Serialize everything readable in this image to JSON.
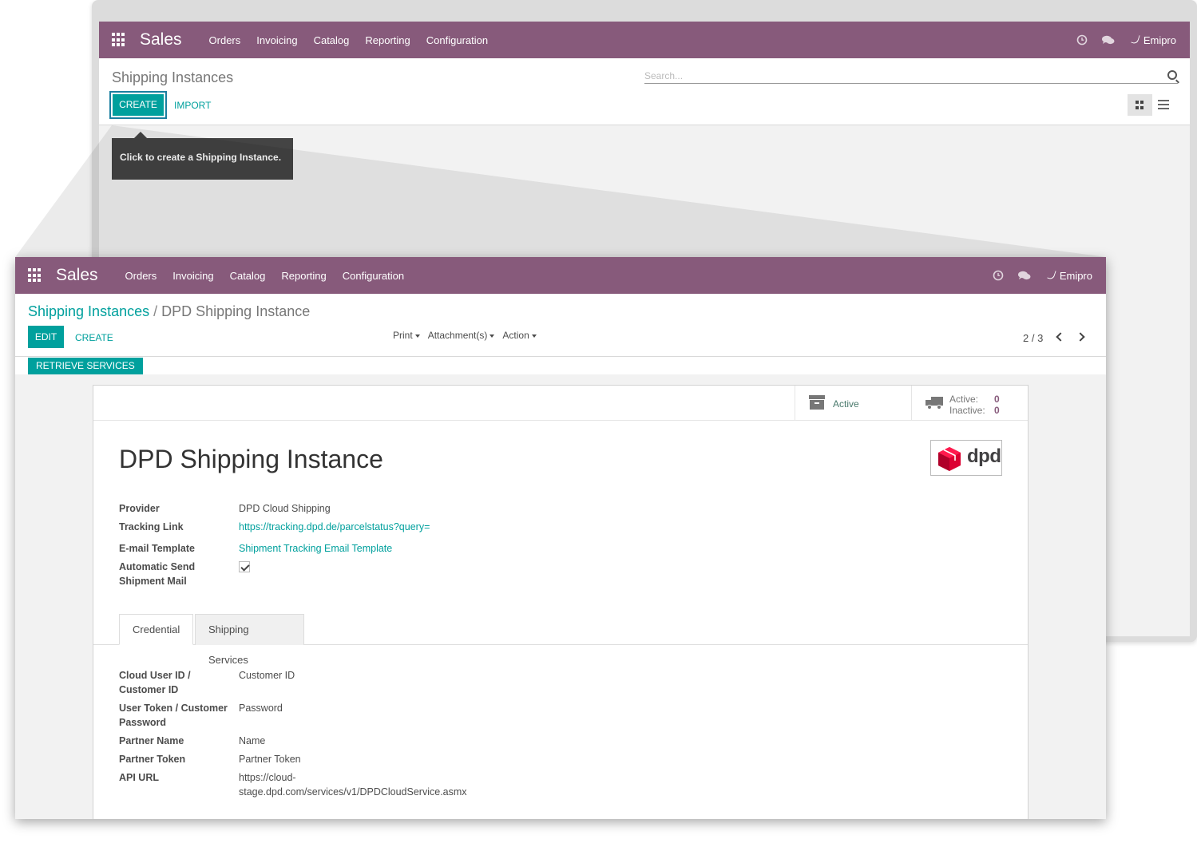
{
  "app": {
    "brand": "Sales",
    "user": "Emipro"
  },
  "menu": [
    "Orders",
    "Invoicing",
    "Catalog",
    "Reporting",
    "Configuration"
  ],
  "back": {
    "title": "Shipping Instances",
    "search_placeholder": "Search...",
    "create_label": "CREATE",
    "import_label": "IMPORT",
    "tooltip": "Click to create a Shipping Instance."
  },
  "front": {
    "breadcrumb_parent": "Shipping Instances",
    "breadcrumb_sep": "/",
    "breadcrumb_current": "DPD Shipping Instance",
    "edit_label": "EDIT",
    "create_label": "CREATE",
    "dropdowns": [
      "Print",
      "Attachment(s)",
      "Action"
    ],
    "pager": "2 / 3",
    "retrieve_label": "RETRIEVE SERVICES",
    "active_label": "Active",
    "counts": {
      "active_label": "Active:",
      "active_value": "0",
      "inactive_label": "Inactive:",
      "inactive_value": "0"
    },
    "record_title": "DPD Shipping Instance",
    "logo_text": "dpd",
    "fields": [
      {
        "label": "Provider",
        "value": "DPD Cloud Shipping"
      },
      {
        "label": "Tracking Link",
        "value": "https://tracking.dpd.de/parcelstatus?query="
      },
      {
        "label": "E-mail Template",
        "value": "Shipment Tracking Email Template"
      },
      {
        "label": "Automatic Send Shipment Mail",
        "checked": true
      }
    ],
    "tabs": [
      "Credential",
      "Shipping Services"
    ],
    "credentials": [
      {
        "label": "Cloud User ID / Customer ID",
        "value": "Customer ID"
      },
      {
        "label": "User Token / Customer Password",
        "value": "Password"
      },
      {
        "label": "Partner Name",
        "value": "Name"
      },
      {
        "label": "Partner Token",
        "value": "Partner Token"
      },
      {
        "label": "API URL",
        "value": "https://cloud-stage.dpd.com/services/v1/DPDCloudService.asmx"
      }
    ]
  },
  "colors": {
    "navbar": "#875a7b",
    "primary": "#00a09d",
    "dpd_red": "#dc0032"
  }
}
